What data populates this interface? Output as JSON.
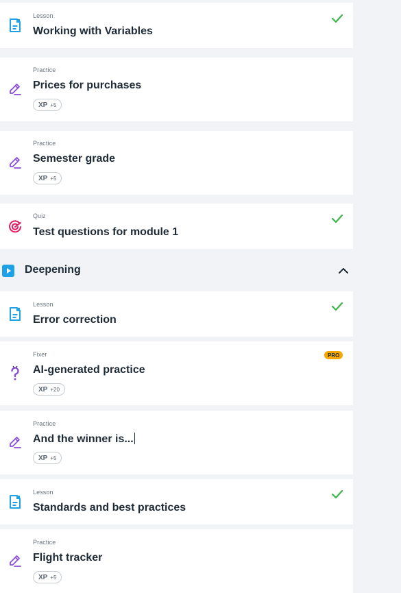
{
  "items_top": [
    {
      "type": "Lesson",
      "title": "Working with Variables",
      "icon": "lesson-icon",
      "completed": true
    },
    {
      "type": "Practice",
      "title": "Prices for purchases",
      "icon": "pencil-icon",
      "xp_label": "XP",
      "xp_value": "+5"
    },
    {
      "type": "Practice",
      "title": "Semester grade",
      "icon": "pencil-icon",
      "xp_label": "XP",
      "xp_value": "+5"
    },
    {
      "type": "Quiz",
      "title": "Test questions for module 1",
      "icon": "target-icon",
      "completed": true
    }
  ],
  "section": {
    "title": "Deepening",
    "icon": "play-icon",
    "expanded": true
  },
  "items_bottom": [
    {
      "type": "Lesson",
      "title": "Error correction",
      "icon": "lesson-icon",
      "completed": true
    },
    {
      "type": "Fixer",
      "title": "AI-generated practice",
      "icon": "question-icon",
      "badge": "PRO",
      "xp_label": "XP",
      "xp_value": "+20"
    },
    {
      "type": "Practice",
      "title": "And the winner is...",
      "icon": "pencil-icon",
      "xp_label": "XP",
      "xp_value": "+5"
    },
    {
      "type": "Lesson",
      "title": "Standards and best practices",
      "icon": "lesson-icon",
      "completed": true
    },
    {
      "type": "Practice",
      "title": "Flight tracker",
      "icon": "pencil-icon",
      "xp_label": "XP",
      "xp_value": "+5"
    }
  ],
  "colors": {
    "lesson": "#1ea1e6",
    "practice": "#8a4fd8",
    "quiz": "#e6195e",
    "check": "#3bb54a",
    "pro": "#f5a700"
  }
}
